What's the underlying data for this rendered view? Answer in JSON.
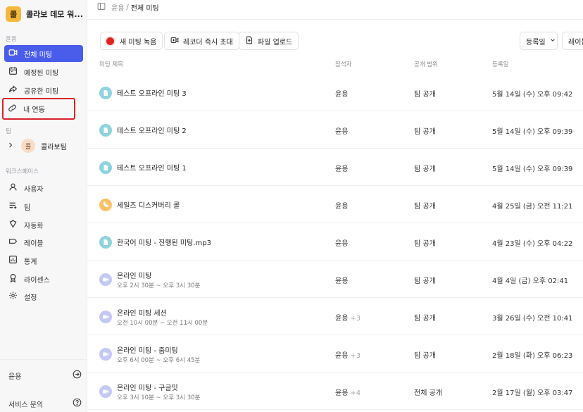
{
  "workspace": {
    "logo_text": "콜",
    "name": "콜라보 데모 워...",
    "logo_color": "#f4b740"
  },
  "breadcrumb": {
    "parent": "윤용",
    "separator": "/",
    "current": "전체 미팅"
  },
  "sidebar": {
    "section_personal": "윤용",
    "section_team": "팀",
    "section_workspace": "워크스페이스",
    "personal_items": [
      {
        "label": "전체 미팅",
        "icon": "video-icon",
        "active": true
      },
      {
        "label": "예정된 미팅",
        "icon": "calendar-icon",
        "active": false
      },
      {
        "label": "공유한 미팅",
        "icon": "share-icon",
        "active": false
      },
      {
        "label": "내 연동",
        "icon": "link-icon",
        "active": false,
        "highlighted": true
      }
    ],
    "team": {
      "avatar": "콜",
      "label": "콜라보팀"
    },
    "workspace_items": [
      {
        "label": "사용자",
        "icon": "user-icon"
      },
      {
        "label": "팀",
        "icon": "team-list-icon"
      },
      {
        "label": "자동화",
        "icon": "automation-icon"
      },
      {
        "label": "레이블",
        "icon": "label-icon"
      },
      {
        "label": "통계",
        "icon": "chart-icon"
      },
      {
        "label": "라이센스",
        "icon": "license-icon"
      },
      {
        "label": "설정",
        "icon": "gear-icon"
      }
    ],
    "bottom": [
      {
        "label": "윤용",
        "icon": "arrow-circle-icon"
      },
      {
        "label": "서비스 문의",
        "icon": "help-circle-icon"
      }
    ],
    "accent_color": "#4a5dea"
  },
  "toolbar": {
    "record_label": "새 미팅 녹음",
    "invite_label": "레코더 즉시 초대",
    "upload_label": "파일 업로드",
    "sort_label": "등록일",
    "label_filter": "레이블"
  },
  "table": {
    "headers": {
      "title": "미팅 제목",
      "attendees": "참석자",
      "scope": "공개 범위",
      "date": "등록일"
    },
    "rows": [
      {
        "title": "테스트 오프라인 미팅 3",
        "sub": "",
        "attendee": "윤용",
        "extra": "",
        "scope": "팀 공개",
        "date": "5월 14일 (수) 오후 09:42",
        "type": "file"
      },
      {
        "title": "테스트 오프라인 미팅 2",
        "sub": "",
        "attendee": "윤용",
        "extra": "",
        "scope": "팀 공개",
        "date": "5월 14일 (수) 오후 09:39",
        "type": "file"
      },
      {
        "title": "테스트 오프라인 미팅 1",
        "sub": "",
        "attendee": "윤용",
        "extra": "",
        "scope": "팀 공개",
        "date": "5월 14일 (수) 오후 09:39",
        "type": "file"
      },
      {
        "title": "세일즈 디스커버리 콜",
        "sub": "",
        "attendee": "윤용",
        "extra": "",
        "scope": "팀 공개",
        "date": "4월 25일 (금) 오전 11:21",
        "type": "phone"
      },
      {
        "title": "한국어 미팅 - 진행된 미팅.mp3",
        "sub": "",
        "attendee": "윤용",
        "extra": "",
        "scope": "팀 공개",
        "date": "4월 23일 (수) 오후 04:22",
        "type": "file"
      },
      {
        "title": "온라인 미팅",
        "sub": "오후 2시 30분 ~ 오후 3시 30분",
        "attendee": "윤용",
        "extra": "",
        "scope": "팀 공개",
        "date": "4월 4일 (금) 오후 02:41",
        "type": "video"
      },
      {
        "title": "온라인 미팅 세션",
        "sub": "오전 10시 00분 ~ 오전 11시 00분",
        "attendee": "윤용",
        "extra": "+3",
        "scope": "팀 공개",
        "date": "3월 26일 (수) 오전 10:41",
        "type": "video"
      },
      {
        "title": "온라인 미팅 - 줌미팅",
        "sub": "오후 6시 00분 ~ 오후 6시 45분",
        "attendee": "윤용",
        "extra": "+3",
        "scope": "팀 공개",
        "date": "2월 18일 (화) 오후 06:23",
        "type": "video"
      },
      {
        "title": "온라인 미팅 - 구글밋",
        "sub": "오후 3시 10분 ~ 오후 3시 30분",
        "attendee": "윤용",
        "extra": "+4",
        "scope": "전체 공개",
        "date": "2월 17일 (월) 오후 03:47",
        "type": "video"
      }
    ]
  },
  "icon_colors": {
    "file": "#8fd3dc",
    "phone": "#f8c26a",
    "video": "#c4c8f4"
  }
}
